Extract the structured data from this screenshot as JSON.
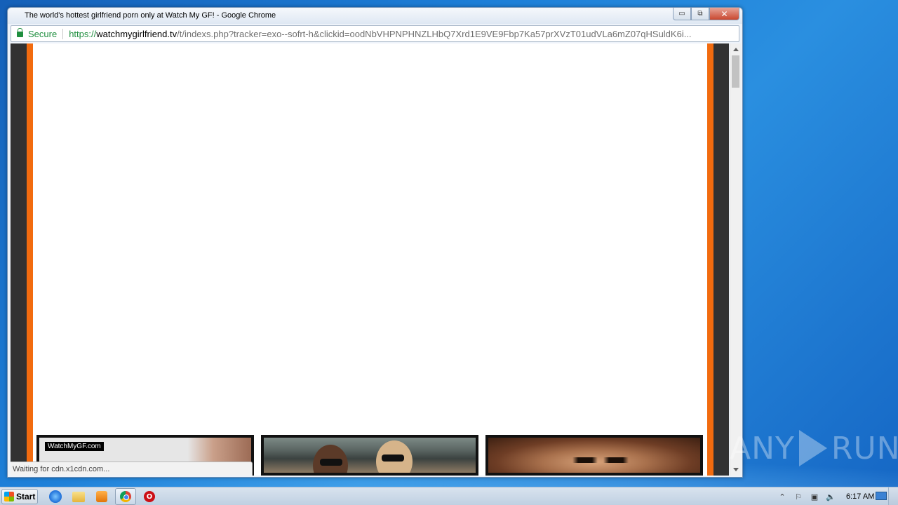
{
  "window": {
    "title": "The world's hottest girlfriend porn only at Watch My GF! - Google Chrome",
    "controls": {
      "minimize": "▭",
      "restore": "⧉",
      "close": "✕"
    }
  },
  "address_bar": {
    "security_label": "Secure",
    "url_scheme": "https://",
    "url_host": "watchmygirlfriend.tv",
    "url_rest": "/t/indexs.php?tracker=exo--sofrt-h&clickid=oodNbVHPNPHNZLHbQ7Xrd1E9VE9Fbp7Ka57prXVzT01udVLa6mZ07qHSuldK6i..."
  },
  "page": {
    "watermark_label": "WatchMyGF.com",
    "colors": {
      "frame": "#323232",
      "accent": "#f26b0f",
      "background": "#ffffff"
    }
  },
  "status_bar": {
    "text": "Waiting for cdn.x1cdn.com..."
  },
  "overlay_watermark": {
    "left": "ANY",
    "right": "RUN"
  },
  "taskbar": {
    "start_label": "Start",
    "opera_glyph": "O",
    "tray": {
      "show_hidden": "⌃",
      "flag": "⚐",
      "network": "▣",
      "volume": "🔈"
    },
    "clock": "6:17 AM"
  }
}
